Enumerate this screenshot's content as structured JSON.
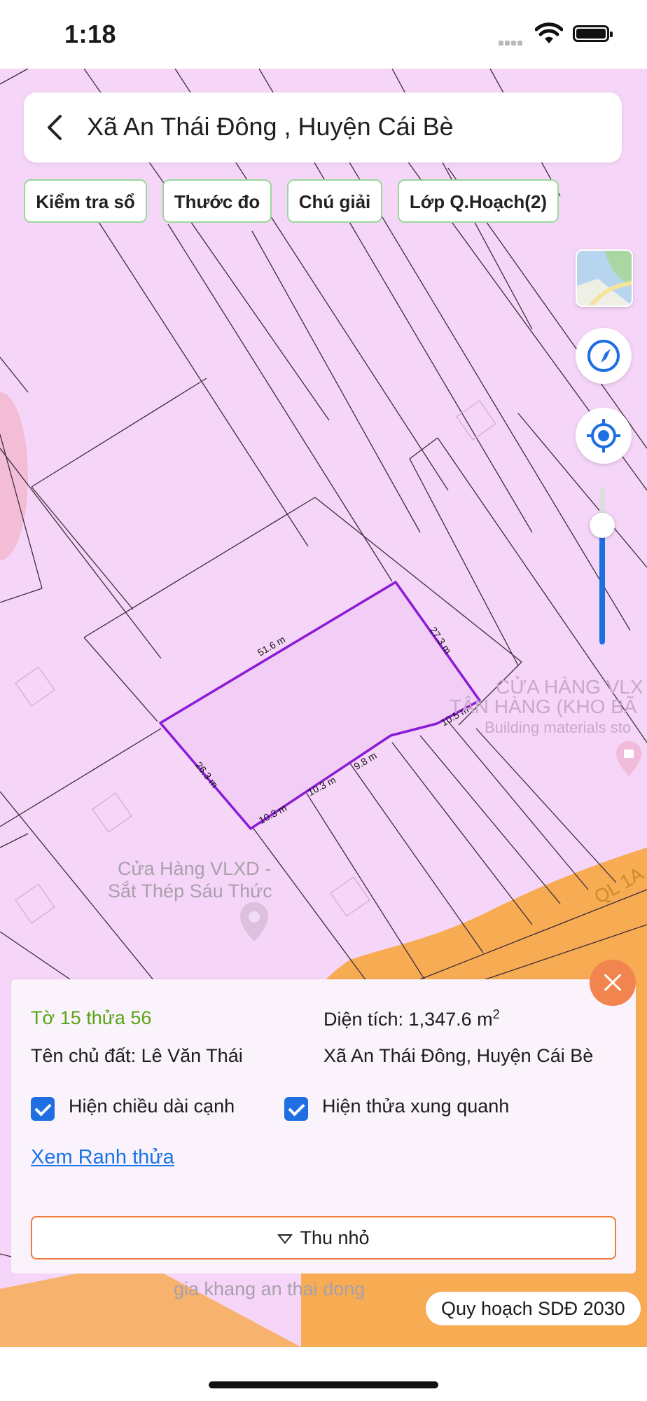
{
  "status": {
    "time": "1:18"
  },
  "header": {
    "title": "Xã An Thái Đông , Huyện Cái Bè"
  },
  "chips": [
    "Kiểm tra sổ",
    "Thước đo",
    "Chú giải",
    "Lớp Q.Hoạch(2)"
  ],
  "map": {
    "edge_lengths": [
      "51.6 m",
      "27.3 m",
      "10.5 m",
      "9.8 m",
      "10.3 m",
      "10.3 m",
      "26.3 m"
    ],
    "store_label_1": "CỬA HÀNG VLX",
    "store_label_2": "TÂN HÀNG (KHO BÃ",
    "store_label_3": "Building materials sto",
    "poi_1_line1": "Cửa Hàng VLXD -",
    "poi_1_line2": "Sắt Thép Sáu Thức",
    "poi_2": "gia khang an thai dong",
    "road_label": "QL 1A"
  },
  "parcel": {
    "sheet_parcel": "Tờ 15 thửa 56",
    "area_label": "Diện tích: 1,347.6 m",
    "area_unit_sup": "2",
    "owner": "Tên chủ đất: Lê Văn Thái",
    "location": "Xã An Thái Đông, Huyện Cái Bè",
    "show_edge_length": "Hiện chiều dài cạnh",
    "show_neighbors": "Hiện thửa xung quanh",
    "view_boundary_link": "Xem Ranh thửa",
    "collapse_label": "Thu nhỏ"
  },
  "plan_layer": "Quy hoạch SDĐ 2030",
  "colors": {
    "land": "#f6d6f8",
    "boundary": "#8a1bd6",
    "accent_orange": "#f2854f",
    "chip_border": "#9ad89a",
    "blue": "#1f6fe3"
  }
}
